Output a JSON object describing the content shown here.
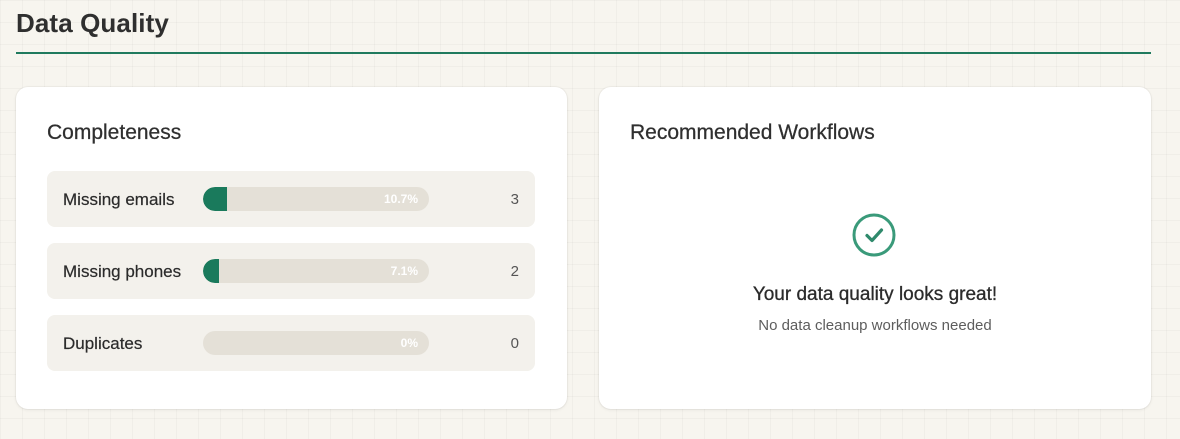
{
  "page": {
    "title": "Data Quality"
  },
  "completeness": {
    "title": "Completeness",
    "rows": [
      {
        "label": "Missing emails",
        "percent_label": "10.7%",
        "fraction": 0.107,
        "count": "3"
      },
      {
        "label": "Missing phones",
        "percent_label": "7.1%",
        "fraction": 0.071,
        "count": "2"
      },
      {
        "label": "Duplicates",
        "percent_label": "0%",
        "fraction": 0,
        "count": "0"
      }
    ]
  },
  "workflows": {
    "title": "Recommended Workflows",
    "empty_icon": "check-circle-icon",
    "empty_title": "Your data quality looks great!",
    "empty_subtitle": "No data cleanup workflows needed"
  },
  "colors": {
    "accent": "#1f7a5e",
    "bar_fill": "#1a7a5c",
    "bar_track": "#e4e0d7",
    "check": "#3a9a7a"
  }
}
